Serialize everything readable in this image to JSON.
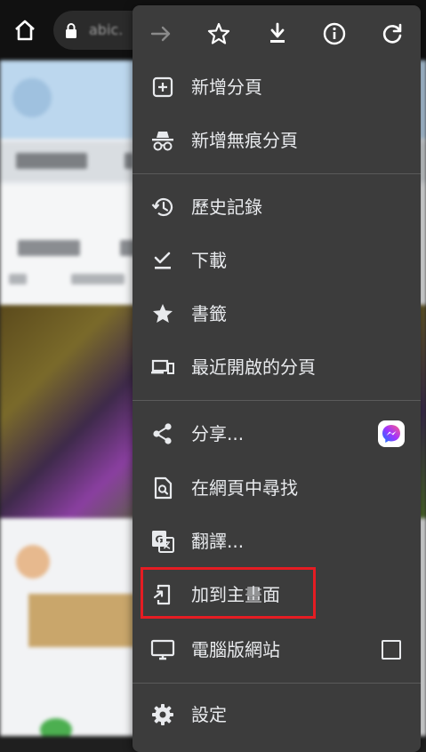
{
  "browser": {
    "url_text": "abic.",
    "icons": [
      "home-icon",
      "lock-icon"
    ]
  },
  "menu": {
    "toolbar": [
      {
        "name": "forward-icon",
        "enabled": false
      },
      {
        "name": "star-outline-icon",
        "enabled": true
      },
      {
        "name": "download-icon",
        "enabled": true
      },
      {
        "name": "info-icon",
        "enabled": true
      },
      {
        "name": "refresh-icon",
        "enabled": true
      }
    ],
    "items": [
      {
        "label": "新增分頁",
        "icon": "new-tab-icon"
      },
      {
        "label": "新增無痕分頁",
        "icon": "incognito-icon"
      },
      {
        "label": "歷史記錄",
        "icon": "history-icon"
      },
      {
        "label": "下載",
        "icon": "downloads-icon"
      },
      {
        "label": "書籤",
        "icon": "bookmark-star-icon"
      },
      {
        "label": "最近開啟的分頁",
        "icon": "recent-tabs-icon"
      },
      {
        "label": "分享...",
        "icon": "share-icon",
        "trailing_icon": "messenger-icon"
      },
      {
        "label": "在網頁中尋找",
        "icon": "find-in-page-icon"
      },
      {
        "label": "翻譯...",
        "icon": "translate-icon"
      },
      {
        "label": "加到主畫面",
        "icon": "add-to-home-screen-icon",
        "highlighted": true
      },
      {
        "label": "電腦版網站",
        "icon": "desktop-site-icon",
        "checkbox_checked": false
      },
      {
        "label": "設定",
        "icon": "settings-icon"
      }
    ]
  },
  "colors": {
    "menu_bg": "#3c3c3c",
    "text": "#e8eaed",
    "highlight": "#e51c23",
    "disabled": "#8a8a8a"
  }
}
